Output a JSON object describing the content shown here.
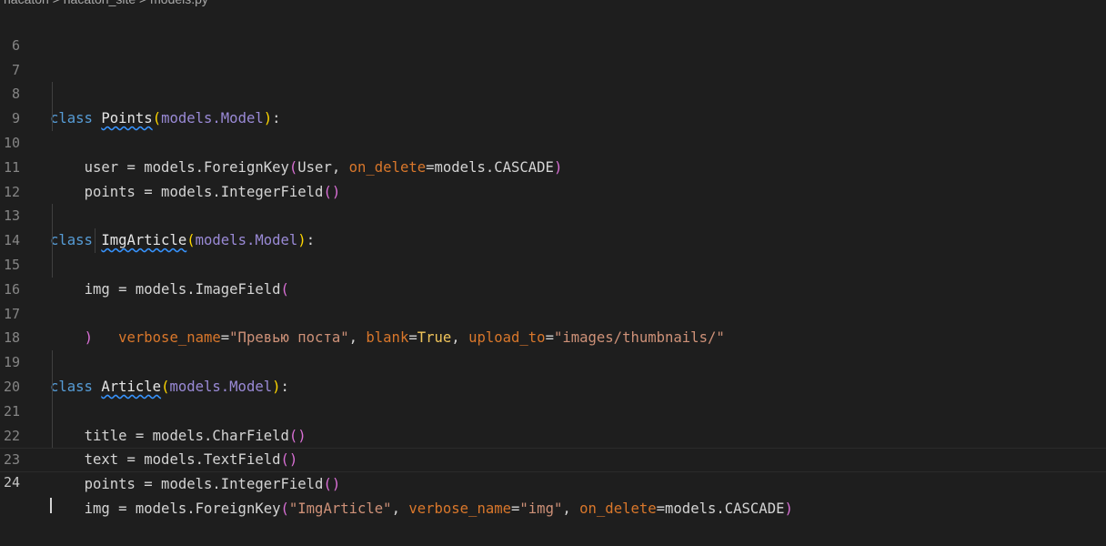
{
  "breadcrumb": "hacaton > hacaton_site > models.py",
  "lines": [
    {
      "n": "6"
    },
    {
      "n": "7"
    },
    {
      "n": "8"
    },
    {
      "n": "9"
    },
    {
      "n": "10"
    },
    {
      "n": "11"
    },
    {
      "n": "12"
    },
    {
      "n": "13"
    },
    {
      "n": "14"
    },
    {
      "n": "15"
    },
    {
      "n": "16"
    },
    {
      "n": "17"
    },
    {
      "n": "18"
    },
    {
      "n": "19"
    },
    {
      "n": "20"
    },
    {
      "n": "21"
    },
    {
      "n": "22"
    },
    {
      "n": "23"
    },
    {
      "n": "24"
    }
  ],
  "code": {
    "kw_class": "class",
    "points_cls": "Points",
    "imgarticle_cls": "ImgArticle",
    "article_cls": "Article",
    "models_model": "models.Model",
    "l9_a": "user = models.ForeignKey",
    "l9_b": "User, ",
    "l9_param": "on_delete",
    "l9_c": "=models.CASCADE",
    "l10_a": "points = models.IntegerField",
    "l14_a": "img = models.ImageField",
    "l15_p1": "verbose_name",
    "l15_s1": "\"Превью поста\"",
    "l15_p2": "blank",
    "l15_const": "True",
    "l15_p3": "upload_to",
    "l15_s3": "\"images/thumbnails/\"",
    "l20_a": "title = models.CharField",
    "l21_a": "text = models.TextField",
    "l22_a": "points = models.IntegerField",
    "l23_a": "img = models.ForeignKey",
    "l23_s1": "\"ImgArticle\"",
    "l23_p1": "verbose_name",
    "l23_s2": "\"img\"",
    "l23_p2": "on_delete",
    "l23_c": "=models.CASCADE"
  },
  "colors": {
    "background": "#1e1e1e",
    "keyword": "#569cd6",
    "parameter": "#d9772b",
    "string": "#ce9178",
    "bracket_gold": "#ffd700",
    "bracket_purple": "#da70d6"
  }
}
